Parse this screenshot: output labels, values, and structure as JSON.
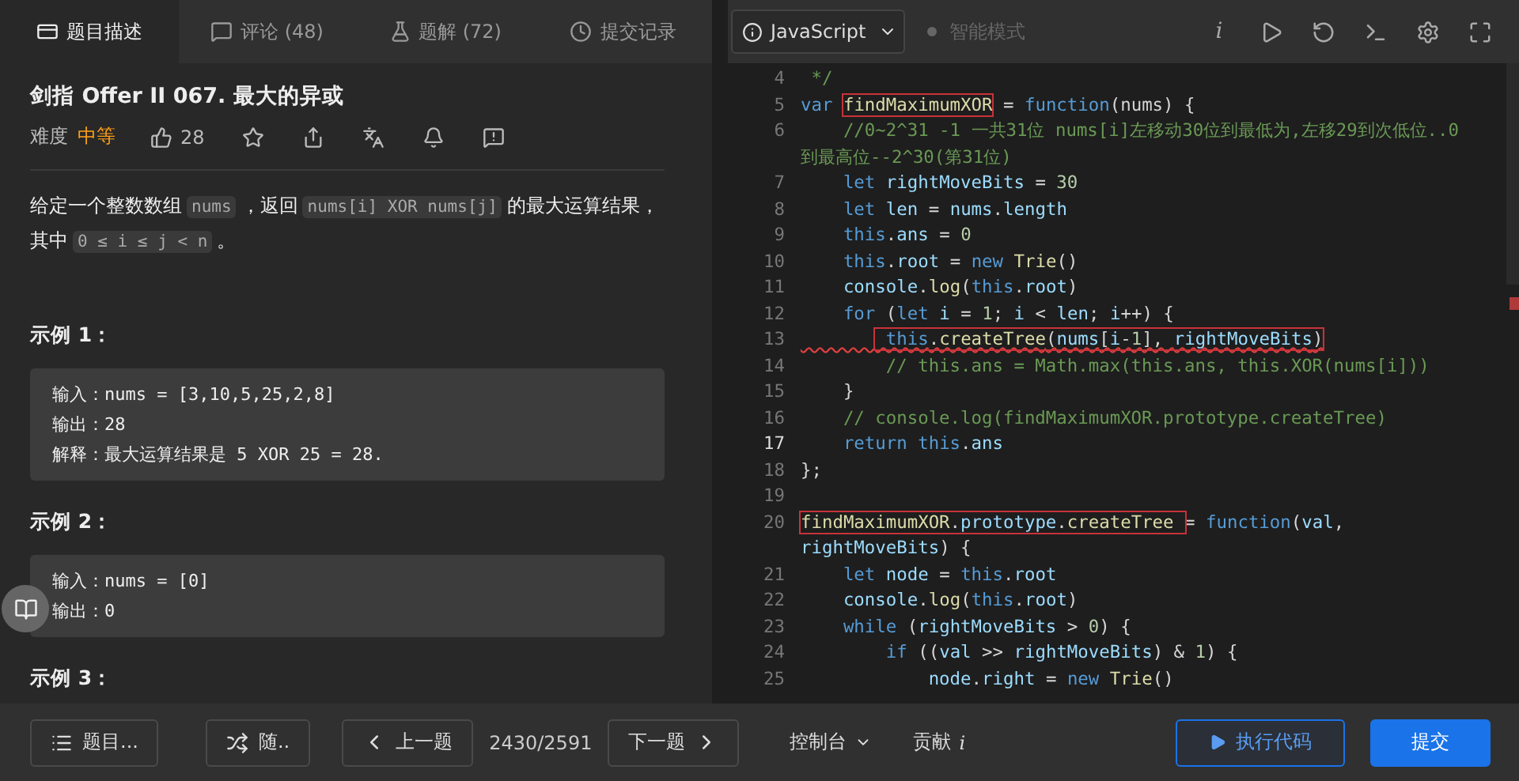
{
  "left_tabs": [
    {
      "label": "题目描述",
      "selected": true
    },
    {
      "label": "评论 (48)",
      "selected": false
    },
    {
      "label": "题解 (72)",
      "selected": false
    },
    {
      "label": "提交记录",
      "selected": false
    }
  ],
  "problem": {
    "title": "剑指 Offer II 067. 最大的异或",
    "difficulty_label": "难度",
    "difficulty": "中等",
    "likes": "28",
    "description": [
      {
        "kind": "text",
        "text": "给定一个整数数组"
      },
      {
        "kind": "code",
        "text": "nums"
      },
      {
        "kind": "text",
        "text": "，返回"
      },
      {
        "kind": "code",
        "text": "nums[i] XOR nums[j]"
      },
      {
        "kind": "text",
        "text": "的最大运算结果，"
      },
      {
        "kind": "text",
        "text": "其中"
      },
      {
        "kind": "code",
        "text": "0 ≤ i ≤ j < n"
      },
      {
        "kind": "text",
        "text": "。"
      }
    ],
    "examples": [
      {
        "title": "示例 1：",
        "lines": [
          "输入：nums = [3,10,5,25,2,8]",
          "输出：28",
          "解释：最大运算结果是 5 XOR 25 = 28."
        ]
      },
      {
        "title": "示例 2：",
        "lines": [
          "输入：nums = [0]",
          "输出：0"
        ]
      },
      {
        "title": "示例 3："
      }
    ]
  },
  "editor_toolbar": {
    "language": "JavaScript",
    "smart_mode": {
      "label": "智能模式",
      "on": false
    },
    "info": "i"
  },
  "code_lines": [
    {
      "number": "4",
      "tokens": [
        {
          "kind": "comment",
          "text": " */"
        }
      ]
    },
    {
      "number": "5",
      "tokens": [
        {
          "kind": "keyword",
          "text": "var "
        },
        {
          "highlighted": true,
          "tokens": [
            {
              "kind": "function",
              "text": "findMaximumXOR"
            }
          ]
        },
        {
          "kind": "plain",
          "text": " = "
        },
        {
          "kind": "keyword",
          "text": "function"
        },
        {
          "kind": "plain",
          "text": "(nums) {"
        }
      ]
    },
    {
      "number": "6",
      "tokens": [
        {
          "kind": "comment",
          "text": "    //0~2^31 -1 一共31位 nums[i]左移动30位到最低为,左移29到次低位..0"
        }
      ]
    },
    {
      "tokens": [
        {
          "kind": "comment",
          "text": "到最高位--2^30(第31位)"
        }
      ]
    },
    {
      "number": "7",
      "tokens": [
        {
          "kind": "keyword",
          "text": "    let "
        },
        {
          "kind": "variable",
          "text": "rightMoveBits"
        },
        {
          "kind": "plain",
          "text": " = "
        },
        {
          "kind": "number",
          "text": "30"
        }
      ]
    },
    {
      "number": "8",
      "tokens": [
        {
          "kind": "keyword",
          "text": "    let "
        },
        {
          "kind": "variable",
          "text": "len"
        },
        {
          "kind": "plain",
          "text": " = "
        },
        {
          "kind": "variable",
          "text": "nums"
        },
        {
          "kind": "plain",
          "text": "."
        },
        {
          "kind": "variable",
          "text": "length"
        }
      ]
    },
    {
      "number": "9",
      "tokens": [
        {
          "kind": "keyword",
          "text": "    this"
        },
        {
          "kind": "plain",
          "text": "."
        },
        {
          "kind": "variable",
          "text": "ans"
        },
        {
          "kind": "plain",
          "text": " = "
        },
        {
          "kind": "number",
          "text": "0"
        }
      ]
    },
    {
      "number": "10",
      "tokens": [
        {
          "kind": "keyword",
          "text": "    this"
        },
        {
          "kind": "plain",
          "text": "."
        },
        {
          "kind": "variable",
          "text": "root"
        },
        {
          "kind": "plain",
          "text": " = "
        },
        {
          "kind": "keyword",
          "text": "new "
        },
        {
          "kind": "function",
          "text": "Trie"
        },
        {
          "kind": "plain",
          "text": "()"
        }
      ]
    },
    {
      "number": "11",
      "tokens": [
        {
          "kind": "variable",
          "text": "    console"
        },
        {
          "kind": "plain",
          "text": "."
        },
        {
          "kind": "function",
          "text": "log"
        },
        {
          "kind": "plain",
          "text": "("
        },
        {
          "kind": "keyword",
          "text": "this"
        },
        {
          "kind": "plain",
          "text": "."
        },
        {
          "kind": "variable",
          "text": "root"
        },
        {
          "kind": "plain",
          "text": ")"
        }
      ]
    },
    {
      "number": "12",
      "tokens": [
        {
          "kind": "keyword",
          "text": "    for "
        },
        {
          "kind": "plain",
          "text": "("
        },
        {
          "kind": "keyword",
          "text": "let "
        },
        {
          "kind": "variable",
          "text": "i"
        },
        {
          "kind": "plain",
          "text": " = "
        },
        {
          "kind": "number",
          "text": "1"
        },
        {
          "kind": "plain",
          "text": "; "
        },
        {
          "kind": "variable",
          "text": "i"
        },
        {
          "kind": "plain",
          "text": " < "
        },
        {
          "kind": "variable",
          "text": "len"
        },
        {
          "kind": "plain",
          "text": "; "
        },
        {
          "kind": "variable",
          "text": "i"
        },
        {
          "kind": "plain",
          "text": "++) {"
        }
      ]
    },
    {
      "number": "13",
      "error": true,
      "tokens": [
        {
          "highlighted": true,
          "tokens": [
            {
              "kind": "keyword",
              "text": "        this"
            },
            {
              "kind": "plain",
              "text": "."
            },
            {
              "kind": "function",
              "text": "createTree"
            },
            {
              "kind": "plain",
              "text": "("
            },
            {
              "kind": "variable",
              "text": "nums"
            },
            {
              "kind": "plain",
              "text": "["
            },
            {
              "kind": "variable",
              "text": "i"
            },
            {
              "kind": "plain",
              "text": "-"
            },
            {
              "kind": "number",
              "text": "1"
            },
            {
              "kind": "plain",
              "text": "], "
            },
            {
              "kind": "variable",
              "text": "rightMoveBits"
            },
            {
              "kind": "plain",
              "text": ")"
            }
          ]
        }
      ]
    },
    {
      "number": "14",
      "tokens": [
        {
          "kind": "comment",
          "text": "        // this.ans = Math.max(this.ans, this.XOR(nums[i]))"
        }
      ]
    },
    {
      "number": "15",
      "tokens": [
        {
          "kind": "plain",
          "text": "    }"
        }
      ]
    },
    {
      "number": "16",
      "tokens": [
        {
          "kind": "comment",
          "text": "    // console.log(findMaximumXOR.prototype.createTree)"
        }
      ]
    },
    {
      "number": "17",
      "current": true,
      "tokens": [
        {
          "kind": "keyword",
          "text": "    return "
        },
        {
          "kind": "keyword",
          "text": "this"
        },
        {
          "kind": "plain",
          "text": "."
        },
        {
          "kind": "variable",
          "text": "ans"
        }
      ]
    },
    {
      "number": "18",
      "tokens": [
        {
          "kind": "plain",
          "text": "};"
        }
      ]
    },
    {
      "number": "19"
    },
    {
      "number": "20",
      "tokens": [
        {
          "highlighted": true,
          "tokens": [
            {
              "kind": "function",
              "text": "findMaximumXOR"
            },
            {
              "kind": "plain",
              "text": "."
            },
            {
              "kind": "variable",
              "text": "prototype"
            },
            {
              "kind": "plain",
              "text": "."
            },
            {
              "kind": "function",
              "text": "createTree "
            }
          ]
        },
        {
          "kind": "plain",
          "text": "= "
        },
        {
          "kind": "keyword",
          "text": "function"
        },
        {
          "kind": "plain",
          "text": "("
        },
        {
          "kind": "variable",
          "text": "val"
        },
        {
          "kind": "plain",
          "text": ","
        }
      ]
    },
    {
      "tokens": [
        {
          "kind": "variable",
          "text": "rightMoveBits"
        },
        {
          "kind": "plain",
          "text": ") {"
        }
      ]
    },
    {
      "number": "21",
      "tokens": [
        {
          "kind": "keyword",
          "text": "    let "
        },
        {
          "kind": "variable",
          "text": "node"
        },
        {
          "kind": "plain",
          "text": " = "
        },
        {
          "kind": "keyword",
          "text": "this"
        },
        {
          "kind": "plain",
          "text": "."
        },
        {
          "kind": "variable",
          "text": "root"
        }
      ]
    },
    {
      "number": "22",
      "tokens": [
        {
          "kind": "variable",
          "text": "    console"
        },
        {
          "kind": "plain",
          "text": "."
        },
        {
          "kind": "function",
          "text": "log"
        },
        {
          "kind": "plain",
          "text": "("
        },
        {
          "kind": "keyword",
          "text": "this"
        },
        {
          "kind": "plain",
          "text": "."
        },
        {
          "kind": "variable",
          "text": "root"
        },
        {
          "kind": "plain",
          "text": ")"
        }
      ]
    },
    {
      "number": "23",
      "tokens": [
        {
          "kind": "keyword",
          "text": "    while "
        },
        {
          "kind": "plain",
          "text": "("
        },
        {
          "kind": "variable",
          "text": "rightMoveBits"
        },
        {
          "kind": "plain",
          "text": " > "
        },
        {
          "kind": "number",
          "text": "0"
        },
        {
          "kind": "plain",
          "text": ") {"
        }
      ]
    },
    {
      "number": "24",
      "tokens": [
        {
          "kind": "keyword",
          "text": "        if "
        },
        {
          "kind": "plain",
          "text": "(("
        },
        {
          "kind": "variable",
          "text": "val"
        },
        {
          "kind": "plain",
          "text": " >> "
        },
        {
          "kind": "variable",
          "text": "rightMoveBits"
        },
        {
          "kind": "plain",
          "text": ") & "
        },
        {
          "kind": "number",
          "text": "1"
        },
        {
          "kind": "plain",
          "text": ") {"
        }
      ]
    },
    {
      "number": "25",
      "tokens": [
        {
          "kind": "variable",
          "text": "            node"
        },
        {
          "kind": "plain",
          "text": "."
        },
        {
          "kind": "variable",
          "text": "right"
        },
        {
          "kind": "plain",
          "text": " = "
        },
        {
          "kind": "keyword",
          "text": "new "
        },
        {
          "kind": "function",
          "text": "Trie"
        },
        {
          "kind": "plain",
          "text": "()"
        }
      ]
    }
  ],
  "bottom_bar": {
    "list_button": "题目...",
    "random_button": "随..",
    "prev_button": "上一题",
    "progress": "2430/2591",
    "next_button": "下一题",
    "console": "控制台",
    "contribute": "贡献",
    "contribute_icon": "i",
    "run_button": "执行代码",
    "submit_button": "提交"
  }
}
